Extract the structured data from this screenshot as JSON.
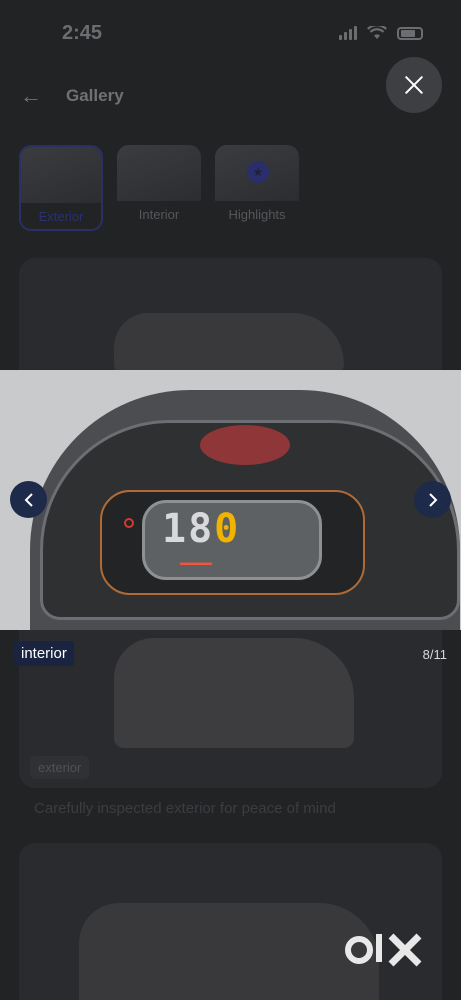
{
  "status_bar": {
    "time": "2:45"
  },
  "header": {
    "title": "Gallery"
  },
  "tabs": [
    {
      "label": "Exterior",
      "active": true
    },
    {
      "label": "Interior",
      "active": false
    },
    {
      "label": "Highlights",
      "active": false
    }
  ],
  "background_card": {
    "badge": "exterior",
    "caption": "Carefully inspected exterior for peace of mind"
  },
  "viewer": {
    "category": "interior",
    "counter": "8/11",
    "current_index": 8,
    "total": 11
  },
  "photo_readout": {
    "speed_dim": "18",
    "speed_lit": "0"
  },
  "brand": {
    "logo": "olx",
    "accent": "#1e2a49"
  },
  "icons": [
    "back-arrow-icon",
    "close-icon",
    "chevron-left-icon",
    "chevron-right-icon",
    "star-icon",
    "signal-icon",
    "wifi-icon",
    "battery-icon"
  ]
}
